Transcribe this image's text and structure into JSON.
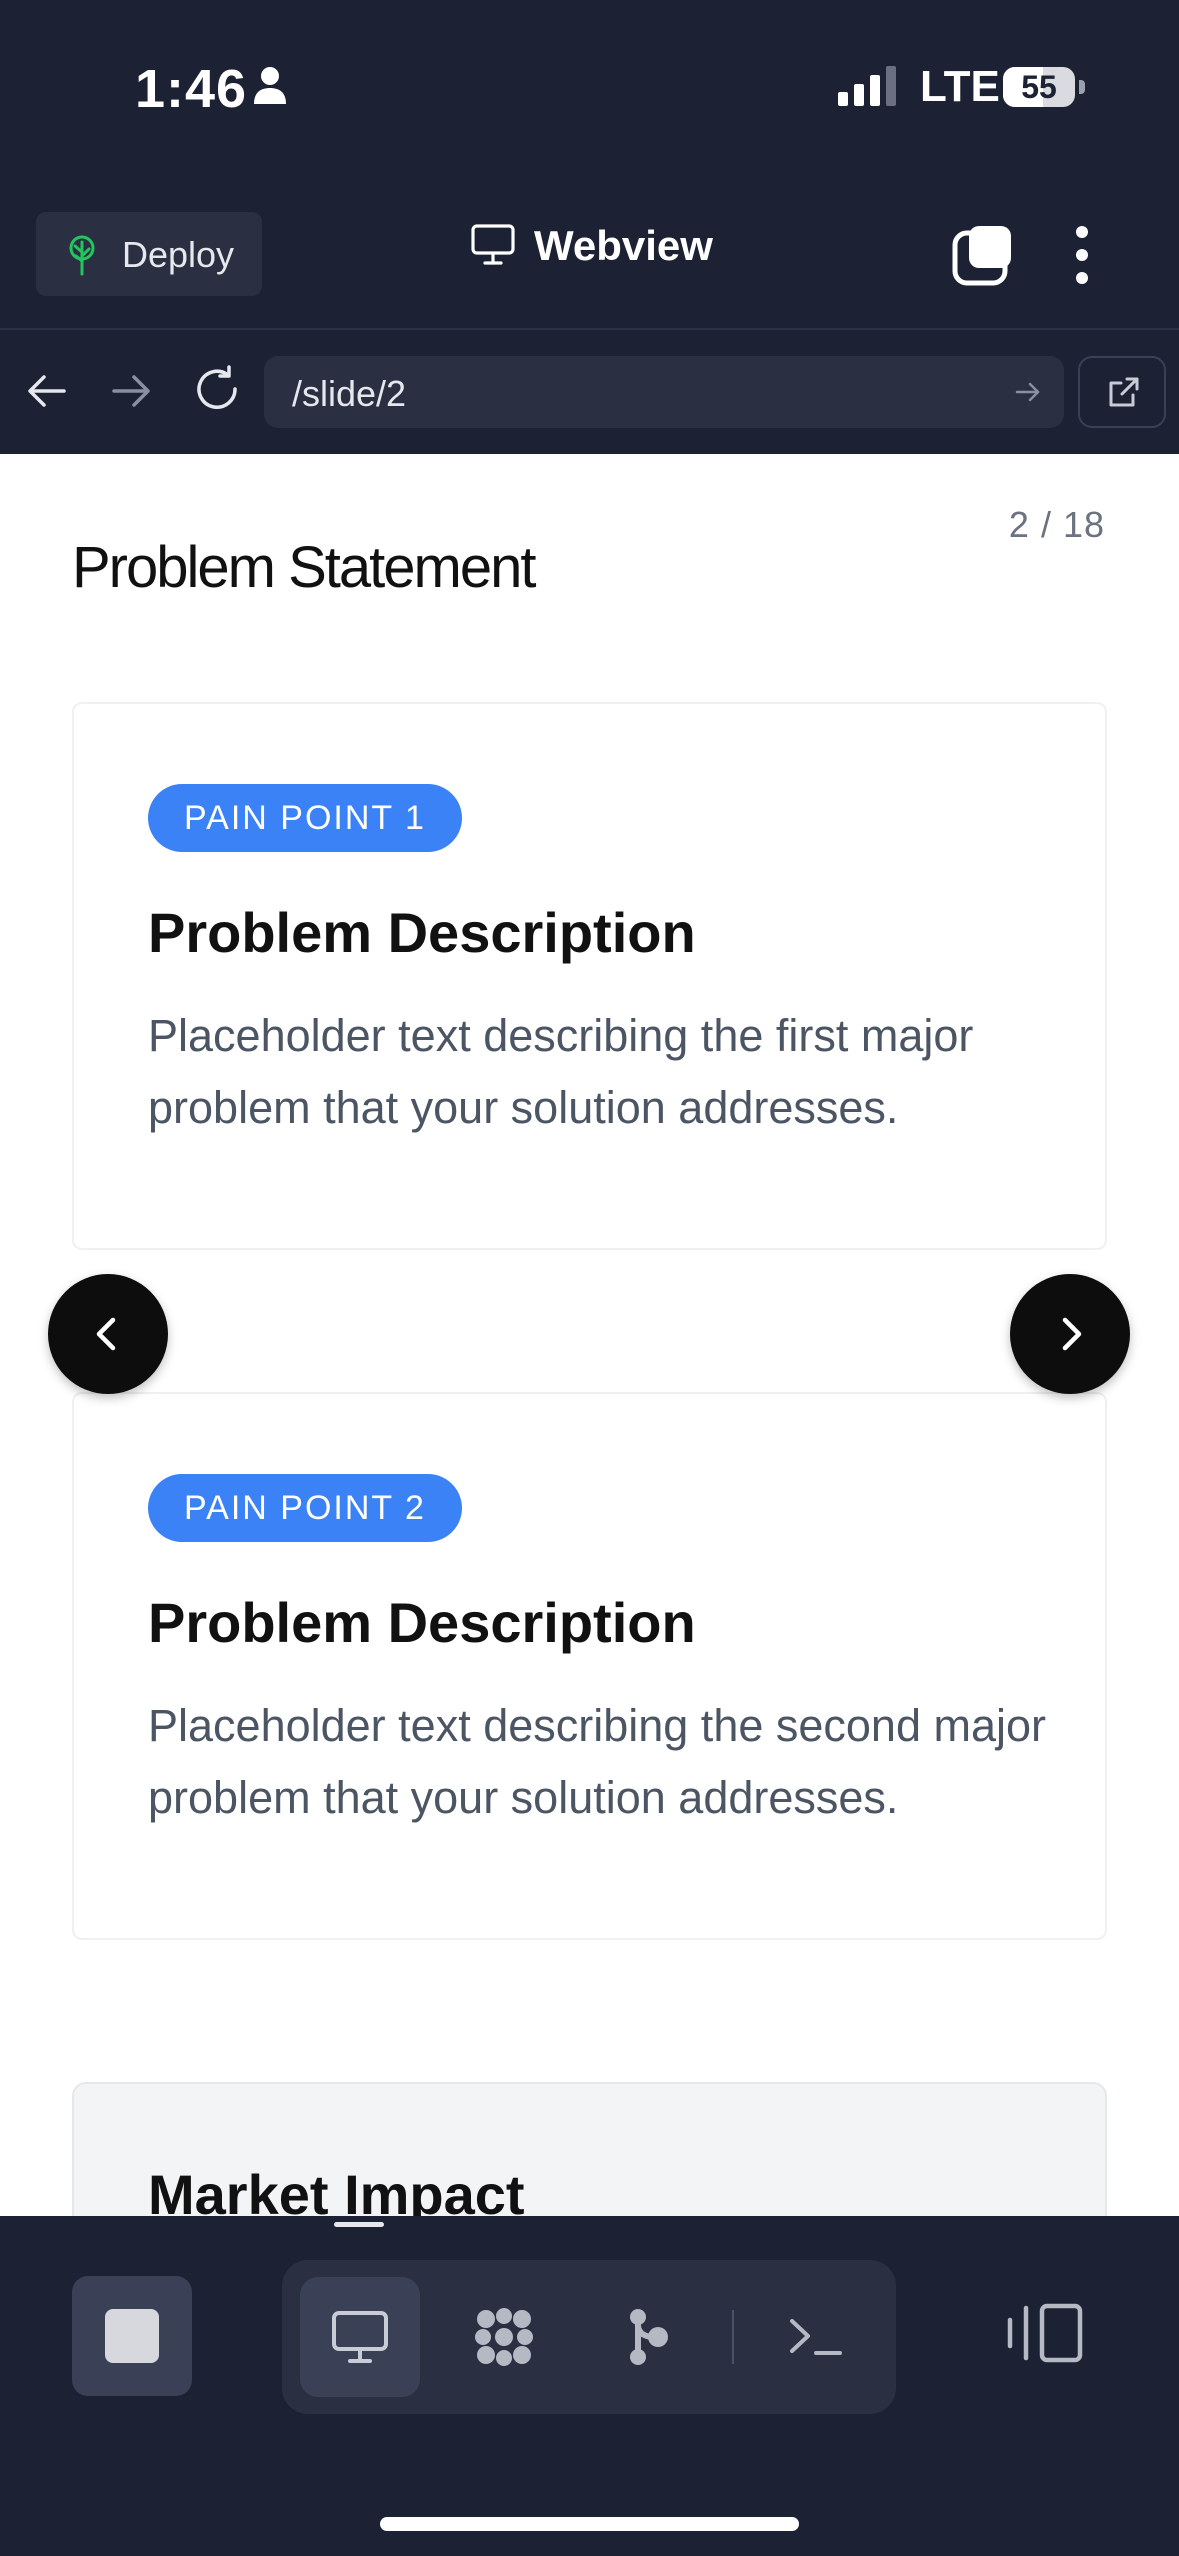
{
  "status_bar": {
    "time": "1:46",
    "network": "LTE",
    "battery": "55",
    "battery_level": 0.55
  },
  "header": {
    "deploy_label": "Deploy",
    "title": "Webview",
    "icons": [
      "deploy-tree-icon",
      "monitor-icon",
      "tabs-icon",
      "more-vertical-icon"
    ]
  },
  "url_bar": {
    "url": "/slide/2",
    "icons": [
      "back-arrow-icon",
      "forward-arrow-icon",
      "reload-icon",
      "go-arrow-icon",
      "external-link-icon"
    ]
  },
  "slide": {
    "counter": "2 / 18",
    "title": "Problem Statement",
    "cards": [
      {
        "badge": "PAIN POINT 1",
        "heading": "Problem Description",
        "body": "Placeholder text describing the first major problem that your solution addresses."
      },
      {
        "badge": "PAIN POINT 2",
        "heading": "Problem Description",
        "body": "Placeholder text describing the second major problem that your solution addresses."
      }
    ],
    "next_section_heading": "Market Impact"
  },
  "toolbar": {
    "tools": [
      "stop-icon",
      "webview-monitor-icon",
      "packages-icon",
      "git-branch-icon",
      "terminal-icon",
      "split-view-icon"
    ],
    "active_tool": "webview-monitor-icon"
  },
  "colors": {
    "chrome_bg": "#1c2133",
    "field_bg": "#2a3042",
    "accent_blue": "#3b82f6",
    "deploy_green": "#22c55e"
  }
}
